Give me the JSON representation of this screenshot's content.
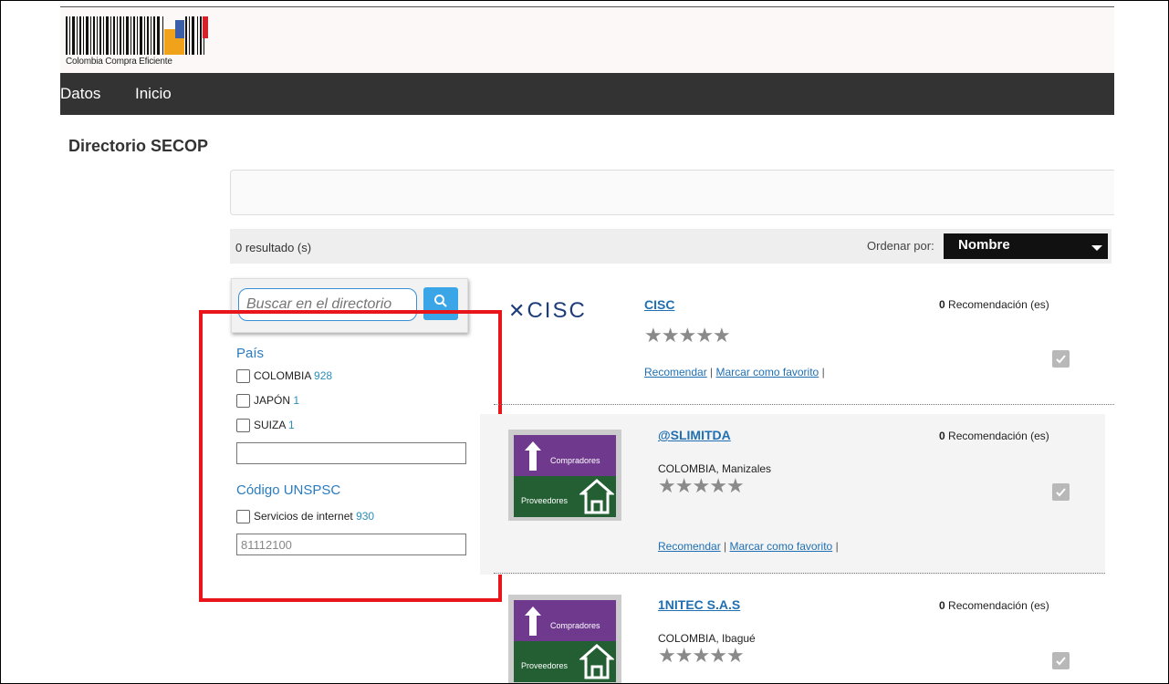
{
  "brand": {
    "name": "Colombia Compra Eficiente"
  },
  "nav": {
    "items": [
      "Datos",
      "Inicio"
    ]
  },
  "page": {
    "title": "Directorio SECOP"
  },
  "results": {
    "count_text": "0 resultado (s)",
    "order_label": "Ordenar por:",
    "order_value": "Nombre"
  },
  "search": {
    "placeholder": "Buscar en el directorio"
  },
  "facets": {
    "country": {
      "title": "País",
      "options": [
        {
          "label": "COLOMBIA",
          "count": "928"
        },
        {
          "label": "JAPÓN",
          "count": "1"
        },
        {
          "label": "SUIZA",
          "count": "1"
        }
      ],
      "input_value": ""
    },
    "unspsc": {
      "title": "Código UNSPSC",
      "options": [
        {
          "label": "Servicios de internet",
          "count": "930"
        }
      ],
      "input_value": "81112100"
    }
  },
  "listing": [
    {
      "name": "CISC",
      "logo_text": "CISC",
      "location": "",
      "recs_count": "0",
      "recs_label": "Recomendación (es)",
      "recommend": "Recomendar",
      "sep": "|",
      "favorite": "Marcar como favorito"
    },
    {
      "name": "@SLIMITDA",
      "location": "COLOMBIA, Manizales",
      "recs_count": "0",
      "recs_label": "Recomendación (es)",
      "recommend": "Recomendar",
      "sep": "|",
      "favorite": "Marcar como favorito",
      "badge_top": "Compradores",
      "badge_bottom": "Proveedores"
    },
    {
      "name": "1NITEC S.A.S",
      "location": "COLOMBIA, Ibagué",
      "recs_count": "0",
      "recs_label": "Recomendación (es)",
      "badge_top": "Compradores",
      "badge_bottom": "Proveedores"
    }
  ],
  "icons": {
    "search": "search-icon",
    "star": "star-icon",
    "check": "check-icon",
    "caret": "caret-down-icon"
  },
  "colors": {
    "nav_bg": "#333333",
    "link": "#1f6fb2",
    "highlight": "#e8161a",
    "badge_purple": "#6f3a8e",
    "badge_green": "#245f33"
  }
}
